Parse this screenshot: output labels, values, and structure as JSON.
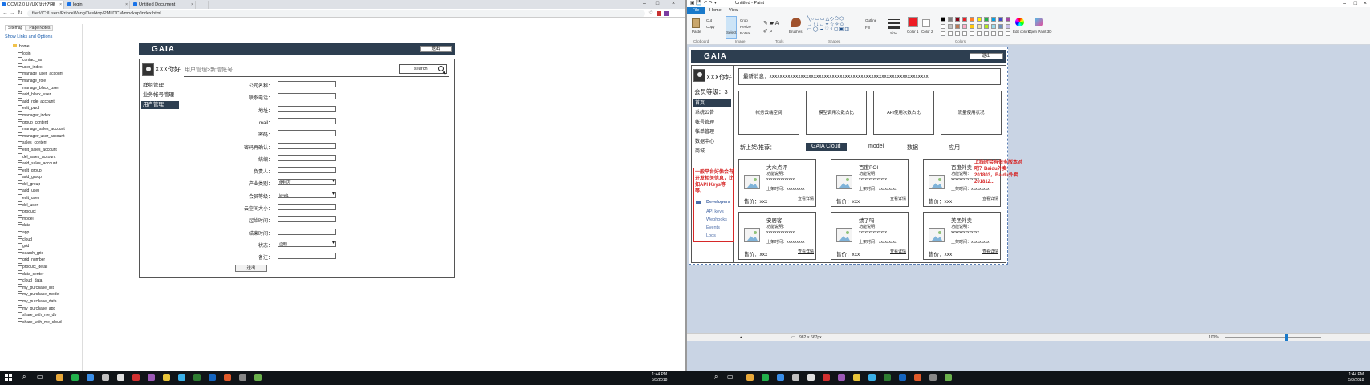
{
  "browser": {
    "tabs": [
      {
        "label": "OCM 2.0 UI/UX设计方案"
      },
      {
        "label": "login"
      },
      {
        "label": "Untitled Document"
      }
    ],
    "url": "file:///C:/Users/PrinceWang/Desktop/PMI/OCM/mockup/index.html",
    "sitemap": {
      "tab_sitemap": "Sitemap",
      "tab_pagenotes": "Page Notes",
      "show_links": "Show Links and Options",
      "root": "home",
      "pages": [
        "login",
        "contact_us",
        "user_index",
        "manage_user_account",
        "manage_role",
        "manage_black_user",
        "add_black_user",
        "add_role_account",
        "edit_pwd",
        "manager_index",
        "group_content",
        "manage_sales_account",
        "manager_user_account",
        "sales_content",
        "edit_sales_account",
        "del_sales_account",
        "add_sales_account",
        "edit_group",
        "add_group",
        "del_group",
        "add_user",
        "edit_user",
        "del_user",
        "product",
        "model",
        "data",
        "app",
        "cloud",
        "grid",
        "search_grid",
        "grid_number",
        "product_detail",
        "data_center",
        "cloud_data",
        "my_purchase_list",
        "my_purchase_model",
        "my_purchase_data",
        "my_purchase_app",
        "share_with_me_db",
        "share_with_me_cloud"
      ]
    }
  },
  "mock_left": {
    "logo": "GAIA",
    "logout": "退出",
    "hello": "XXX你好",
    "nav": [
      "群组管理",
      "业务帐号管理",
      "用户管理"
    ],
    "breadcrumb": "用户管理>新增帐号",
    "search": "search",
    "form": [
      {
        "label": "公司名称：",
        "value": ""
      },
      {
        "label": "联系电话：",
        "value": ""
      },
      {
        "label": "地址：",
        "value": ""
      },
      {
        "label": "mail：",
        "value": ""
      },
      {
        "label": "密码：",
        "value": ""
      },
      {
        "label": "密码再确认：",
        "value": ""
      },
      {
        "label": "统编：",
        "value": ""
      },
      {
        "label": "负责人：",
        "value": ""
      },
      {
        "label": "产业类别：",
        "value": "便利店"
      },
      {
        "label": "会员等级：",
        "value": "level1"
      },
      {
        "label": "云空间大小：",
        "value": ""
      },
      {
        "label": "起始时间：",
        "value": ""
      },
      {
        "label": "结束时间：",
        "value": ""
      },
      {
        "label": "状态：",
        "value": "启用"
      },
      {
        "label": "备注：",
        "value": ""
      }
    ],
    "submit": "送出"
  },
  "paint": {
    "title": "Untitled - Paint",
    "menu": [
      "File",
      "Home",
      "View"
    ],
    "groups": [
      "Clipboard",
      "Image",
      "Tools",
      "Shapes",
      "Colors"
    ],
    "clip": [
      "Paste",
      "Cut",
      "Copy"
    ],
    "image": [
      "Crop",
      "Resize",
      "Rotate",
      "Select"
    ],
    "tools_brushes": "Brushes",
    "shapes_opts": [
      "Outline",
      "Fill"
    ],
    "size": "Size",
    "color1": "Color 1",
    "color2": "Color 2",
    "edit_colors": "Edit colors",
    "open_3d": "Open Paint 3D",
    "status_dims": "982 × 667px",
    "zoom": "100%",
    "palette": [
      "#000000",
      "#7f7f7f",
      "#880015",
      "#ed1c24",
      "#ff7f27",
      "#fff200",
      "#22b14c",
      "#00a2e8",
      "#3f48cc",
      "#a349a4",
      "#ffffff",
      "#c3c3c3",
      "#b97a57",
      "#ffaec9",
      "#ffc90e",
      "#efe4b0",
      "#b5e61d",
      "#99d9ea",
      "#7092be",
      "#c8bfe7"
    ],
    "color1_value": "#ed1c24"
  },
  "mock_right": {
    "logo": "GAIA",
    "logout": "退出",
    "hello": "XXX你好",
    "level": "会员等级：3",
    "nav": [
      "首页",
      "系统公告",
      "帐号管理",
      "帐单管理",
      "数据中心",
      "商城"
    ],
    "red_note": "一般平台好像会有开发相关信息，比如API Keys等等。",
    "dev_items": [
      "Developers",
      "API keys",
      "Webhooks",
      "Events",
      "Logs"
    ],
    "news": "最新消息：xxxxxxxxxxxxxxxxxxxxxxxxxxxxxxxxxxxxxxxxxxxxxxxxxxxxxxxxxxxxx",
    "boxes": [
      "帐务云端空间",
      "模型调用次数占比",
      "API使用次数占比",
      "流量使用状况"
    ],
    "rec_label": "新上架/推荐：",
    "rec_tabs": [
      "GAIA Cloud",
      "model",
      "数据",
      "应用"
    ],
    "cards": [
      {
        "name": "大众点评",
        "fn": "功能说明：",
        "fnv": "xxxxxxxxxxxxxx",
        "up": "上架时间：xxxxxxxxx",
        "price": "售价：xxx",
        "detail": "查看详情"
      },
      {
        "name": "百度POI",
        "fn": "功能说明：",
        "fnv": "xxxxxxxxxxxxxx",
        "up": "上架时间：xxxxxxxxx",
        "price": "售价：xxx",
        "detail": "查看详情"
      },
      {
        "name": "百度外卖",
        "fn": "功能说明：",
        "fnv": "xxxxxxxxxxxxxx",
        "up": "上架时间：xxxxxxxxx",
        "price": "售价：xxx",
        "detail": "查看详情"
      },
      {
        "name": "安居客",
        "fn": "功能说明：",
        "fnv": "xxxxxxxxxxxxxx",
        "up": "上架时间：xxxxxxxxx",
        "price": "售价：xxx",
        "detail": "查看详情"
      },
      {
        "name": "绩了吗",
        "fn": "功能说明：",
        "fnv": "xxxxxxxxxxxxxx",
        "up": "上架时间：xxxxxxxxx",
        "price": "售价：xxx",
        "detail": "查看详情"
      },
      {
        "name": "美团外卖",
        "fn": "功能说明：",
        "fnv": "xxxxxxxxxxxxxx",
        "up": "上架时间：xxxxxxxxx",
        "price": "售价：xxx",
        "detail": "查看详情"
      }
    ],
    "anno": "上线时会有很多版本对吧？Baidu外卖201803，Baidu外卖201812..."
  },
  "taskbar": {
    "left_time": "1:44 PM",
    "left_date": "5/3/2018",
    "right_time": "1:44 PM",
    "right_date": "5/3/2018"
  }
}
